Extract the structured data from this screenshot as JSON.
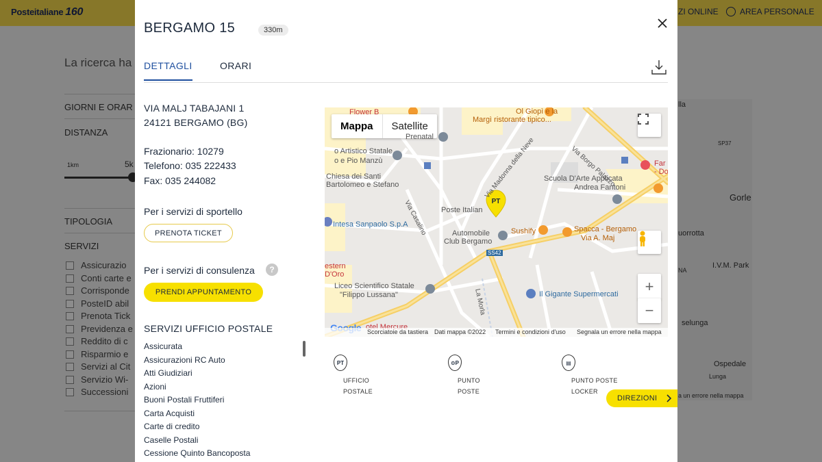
{
  "header": {
    "logo_text": "Posteitaliane",
    "logo_badge": "160",
    "nav_online": "ZI ONLINE",
    "nav_area": "AREA PERSONALE"
  },
  "background": {
    "search_text": "La ricerca ha",
    "section_days": "GIORNI E ORAR",
    "section_distance": "DISTANZA",
    "km_min": "1km",
    "km_value": "5k",
    "section_type": "TIPOLOGIA",
    "section_services": "SERVIZI",
    "checkboxes": [
      "Assicurazio",
      "Conti carte e",
      "Corrisponde",
      "PosteID abil",
      "Prenota Tick",
      "Previdenza e",
      "Reddito di c",
      "Risparmio e",
      "Servizi al Cit",
      "Servizio Wi-",
      "Successioni"
    ],
    "map_labels": [
      "lla",
      "SP37",
      "Gorle",
      "uorrotta",
      "I.V.M. Park",
      "NA",
      "selunga",
      "Ospedale",
      "Lunga",
      "a un errore nella mappa"
    ]
  },
  "modal": {
    "title": "BERGAMO 15",
    "distance": "330m",
    "tabs": [
      {
        "label": "DETTAGLI",
        "active": true
      },
      {
        "label": "ORARI",
        "active": false
      }
    ],
    "address_line1": "VIA MALJ TABAJANI 1",
    "address_line2": "24121 BERGAMO (BG)",
    "frazionario": "Frazionario: 10279",
    "telefono": "Telefono: 035 222433",
    "fax": "Fax: 035 244082",
    "sportello_label": "Per i servizi di sportello",
    "prenota_button": "PRENOTA TICKET",
    "consulenza_label": "Per i servizi di consulenza",
    "help_glyph": "?",
    "appuntamento_button": "PRENDI APPUNTAMENTO",
    "services_heading": "SERVIZI UFFICIO POSTALE",
    "services": [
      "Assicurata",
      "Assicurazioni RC Auto",
      "Atti Giudiziari",
      "Azioni",
      "Buoni Postali Fruttiferi",
      "Carta Acquisti",
      "Carte di credito",
      "Caselle Postali",
      "Cessione Quinto Bancoposta"
    ]
  },
  "map": {
    "type_map": "Mappa",
    "type_satellite": "Satellite",
    "marker_label": "PT",
    "zoom_in": "+",
    "zoom_out": "−",
    "labels": {
      "prenatal": "Prenatal",
      "liceo_artistico": "o Artistico Statale",
      "liceo_artistico2": "o e Pio Manzù",
      "chiesa1": "Chiesa dei Santi",
      "chiesa2": "Bartolomeo e Stefano",
      "intesa": "Intesa Sanpaolo S.p.A",
      "western1": "estern",
      "western2": "D'Oro",
      "liceo_sci1": "Liceo Scientifico Statale",
      "liceo_sci2": "\"Filippo Lussana\"",
      "mercure": "otel Mercure",
      "ol_giopi": "Ol Giopì e la",
      "margi": "Margì ristorante tipico...",
      "borgo": "Via Borgo Palazzo",
      "madonna": "Via Madonna della Neve",
      "scuola1": "Scuola D'Arte Applicata",
      "scuola2": "Andrea Fantoni",
      "poste": "Poste Italian",
      "casalino": "Via Casalino",
      "automobile1": "Automobile",
      "automobile2": "Club Bergamo",
      "sushify": "Sushify",
      "spacca1": "Spacca - Bergamo",
      "spacca2": "Via A. Maj",
      "ss42": "SS42",
      "gigante": "Il Gigante Supermercati",
      "morla": "La Morla",
      "far": "Far",
      "do": "- Do",
      "flower": "Flower B"
    },
    "footer": {
      "google": "Google",
      "shortcuts": "Scorciatoie da tastiera",
      "data": "Dati mappa ©2022",
      "terms": "Termini e condizioni d'uso",
      "report": "Segnala un errore nella mappa"
    }
  },
  "legend": [
    {
      "icon": "PT",
      "line1": "UFFICIO",
      "line2": "POSTALE"
    },
    {
      "icon": "⊙P",
      "line1": "PUNTO",
      "line2": "POSTE"
    },
    {
      "icon": "▤",
      "line1": "PUNTO POSTE",
      "line2": "LOCKER"
    }
  ],
  "directions_button": "DIREZIONI",
  "colors": {
    "brand_yellow": "#f7e000",
    "header_yellow": "#f6d94c",
    "accent_blue": "#1d4e9e",
    "text_dark": "#1d2a3c"
  }
}
